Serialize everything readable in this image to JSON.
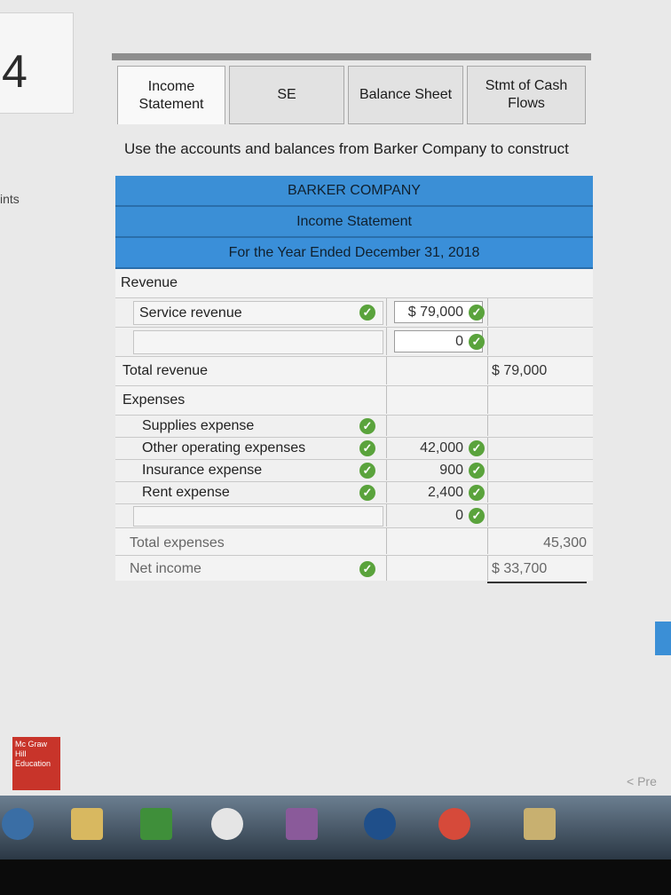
{
  "question": {
    "number": "4",
    "points_label": "ints"
  },
  "tabs": [
    {
      "label": "Income Statement"
    },
    {
      "label": "SE"
    },
    {
      "label": "Balance Sheet"
    },
    {
      "label": "Stmt of Cash Flows"
    }
  ],
  "instruction": "Use the accounts and balances from Barker Company to construct",
  "statement": {
    "company": "BARKER COMPANY",
    "title": "Income Statement",
    "period": "For the Year Ended December 31, 2018",
    "revenue_heading": "Revenue",
    "service_revenue_label": "Service revenue",
    "service_revenue_amount": "$ 79,000",
    "blank_revenue_amount": "0",
    "total_revenue_label": "Total revenue",
    "total_revenue_amount": "$ 79,000",
    "expenses_heading": "Expenses",
    "supplies_label": "Supplies expense",
    "other_operating_label": "Other operating expenses",
    "other_operating_amount": "42,000",
    "insurance_label": "Insurance expense",
    "insurance_amount": "900",
    "rent_label": "Rent expense",
    "rent_amount": "2,400",
    "blank_expense_amount": "0",
    "total_expenses_label": "Total expenses",
    "total_expenses_amount": "45,300",
    "net_income_label": "Net income",
    "net_income_amount": "$ 33,700"
  },
  "nav": {
    "prev_label": "< Pre"
  },
  "logo_text": "Mc Graw Hill Education",
  "colors": {
    "header_blue": "#3b8fd6",
    "check_green": "#5aa33c"
  },
  "icons": {
    "check": "check-circle-icon",
    "taskbar": [
      "ie-icon",
      "folder-icon",
      "store-icon",
      "media-icon",
      "photos-icon",
      "hp-icon",
      "chrome-icon",
      "explorer-icon"
    ]
  }
}
